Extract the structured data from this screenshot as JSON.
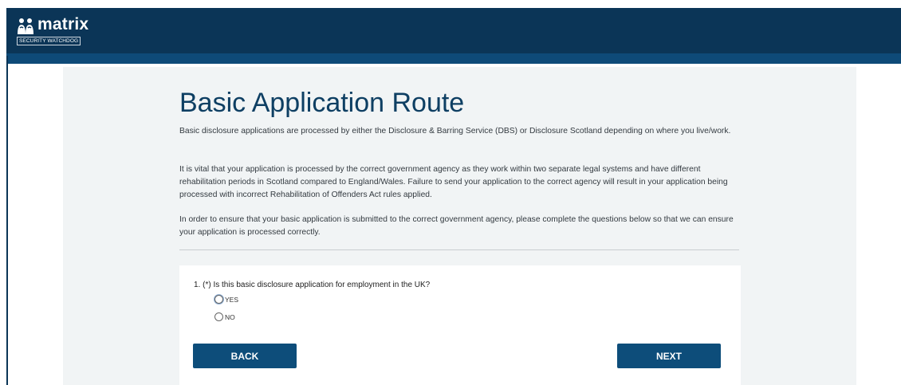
{
  "header": {
    "brand": "matrix",
    "tagline": "SECURITY WATCHDOG",
    "colors": {
      "header": "#0b3557",
      "band": "#0e4a78",
      "accent": "#0d4d7a"
    }
  },
  "main": {
    "title": "Basic Application Route",
    "paragraphs": [
      "Basic disclosure applications are processed by either the Disclosure & Barring Service (DBS) or Disclosure Scotland depending on where you live/work.",
      "It is vital that your application is processed by the correct government agency as they work within two separate legal systems and have different rehabilitation periods in Scotland compared to England/Wales. Failure to send your application to the correct agency will result in your application being processed with incorrect Rehabilitation of Offenders Act rules applied.",
      "In order to ensure that your basic application is submitted to the correct government agency, please complete the questions below so that we can ensure your application is processed correctly."
    ]
  },
  "form": {
    "question": "1. (*) Is this basic disclosure application for employment in the UK?",
    "options": [
      "YES",
      "NO"
    ],
    "back_label": "BACK",
    "next_label": "NEXT"
  }
}
